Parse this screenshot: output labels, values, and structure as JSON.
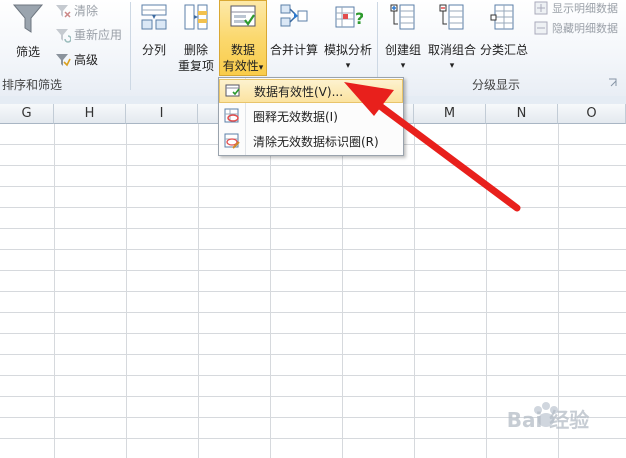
{
  "ribbon": {
    "sort_filter": {
      "filter_label": "筛选",
      "clear_label": "清除",
      "reapply_label": "重新应用",
      "advanced_label": "高级",
      "group_label": "排序和筛选"
    },
    "data_tools": {
      "split_label": "分列",
      "remove_dup_line1": "删除",
      "remove_dup_line2": "重复项",
      "validation_line1": "数据",
      "validation_line2": "有效性",
      "validation_arrow": "▾",
      "consolidate_label": "合并计算",
      "whatif_label": "模拟分析",
      "whatif_arrow": "▾"
    },
    "outline": {
      "group_label": "创建组",
      "ungroup_label": "取消组合",
      "subtotal_label": "分类汇总",
      "show_detail_label": "显示明细数据",
      "hide_detail_label": "隐藏明细数据",
      "group_arrow": "▾",
      "ungroup_arrow": "▾",
      "section_label": "分级显示"
    }
  },
  "dropdown": {
    "items": [
      {
        "label": "数据有效性(V)..."
      },
      {
        "label": "圈释无效数据(I)"
      },
      {
        "label": "清除无效数据标识圈(R)"
      }
    ]
  },
  "columns": [
    "G",
    "H",
    "I",
    "",
    "",
    "",
    "M",
    "N",
    "O"
  ],
  "watermark": {
    "text": "Bai 经验"
  },
  "colors": {
    "arrow": "#e8201c",
    "highlight": "#fbd86e"
  }
}
